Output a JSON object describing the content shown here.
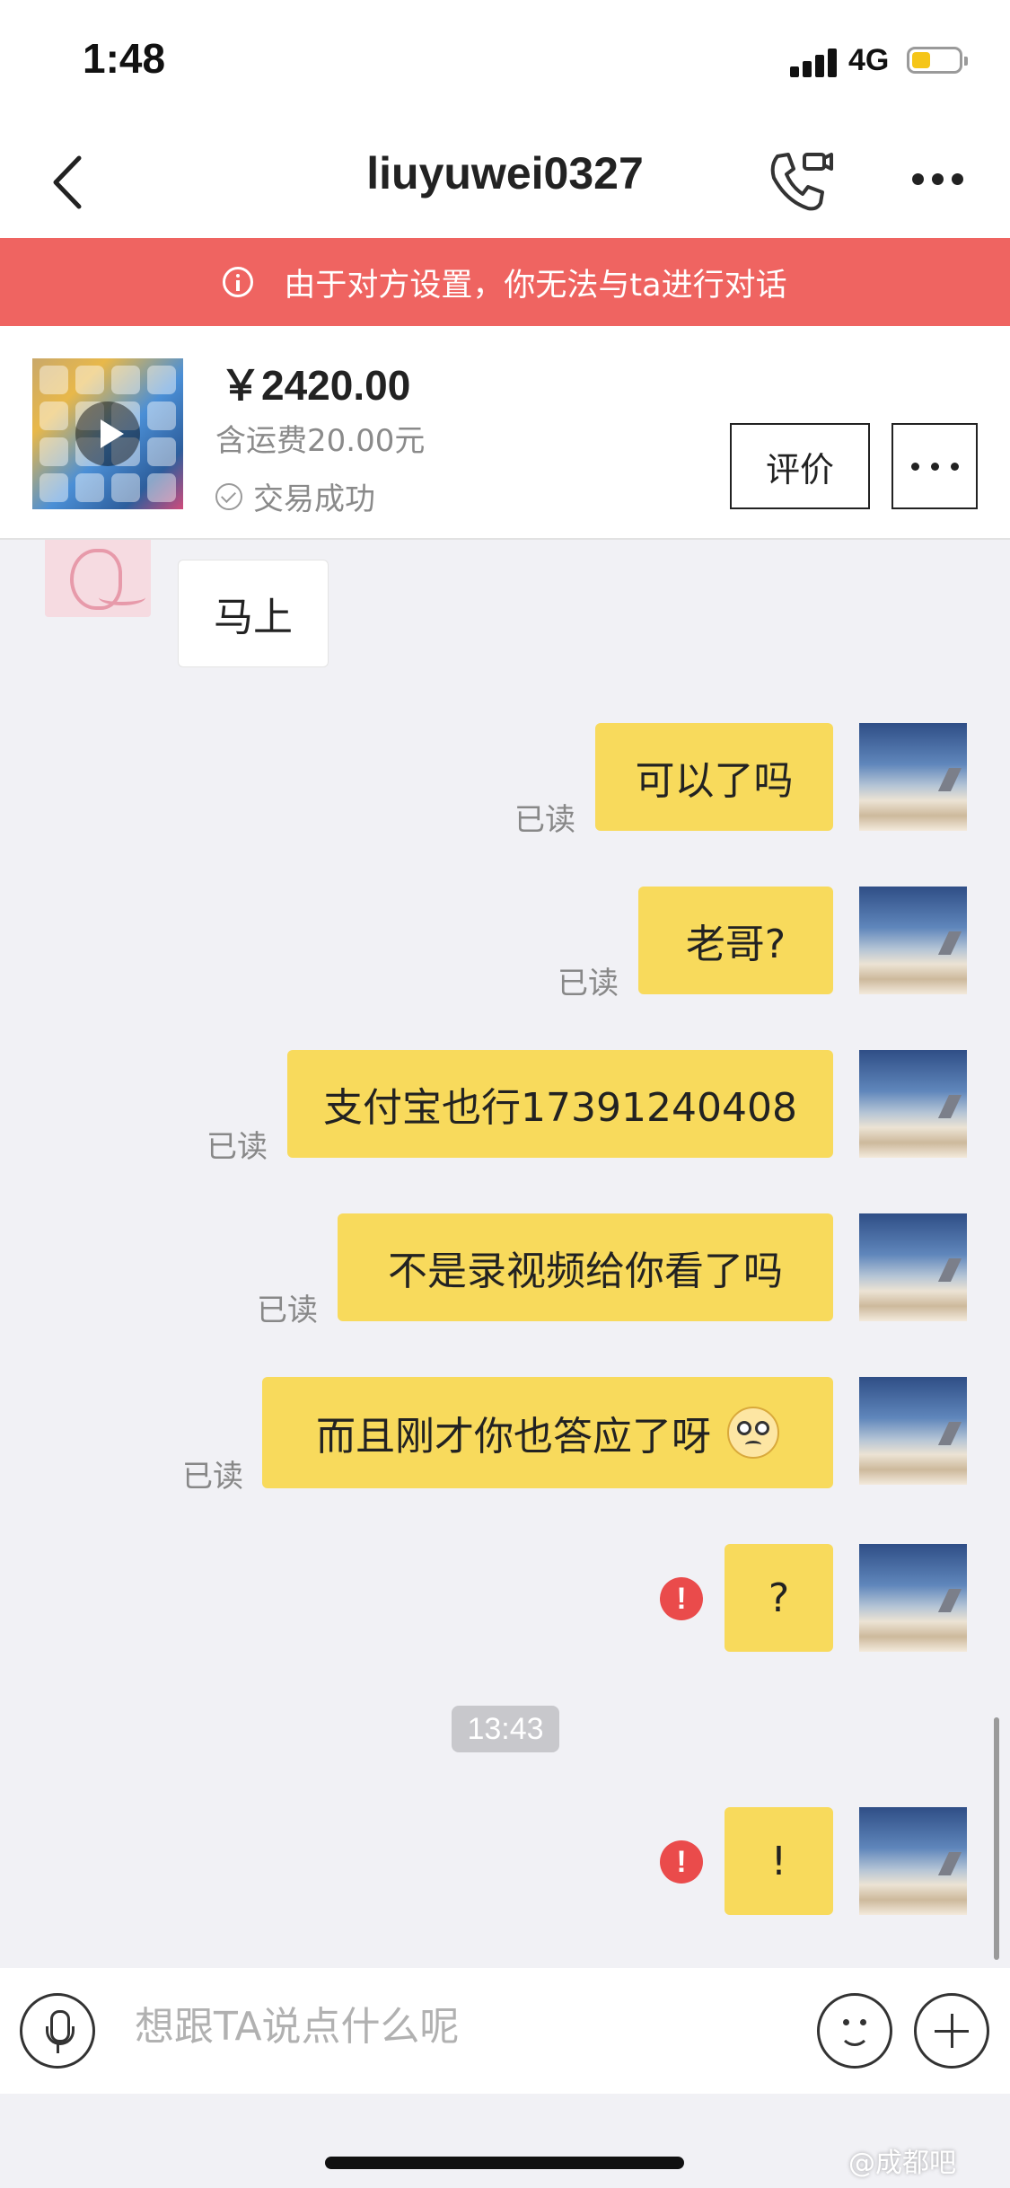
{
  "status_bar": {
    "time": "1:48",
    "network": "4G",
    "battery_level": 0.4
  },
  "nav": {
    "title": "liuyuwei0327",
    "back_icon": "chevron-left-icon",
    "call_icon": "phone-video-icon",
    "more_icon": "more-dots-icon"
  },
  "banner": {
    "text": "由于对方设置，你无法与ta进行对话",
    "color": "#ef6461",
    "icon": "info-icon"
  },
  "product": {
    "price": "￥2420.00",
    "shipping": "含运费20.00元",
    "status": "交易成功",
    "rate_label": "评价"
  },
  "messages": [
    {
      "side": "in",
      "text": "马上"
    },
    {
      "side": "out",
      "text": "可以了吗",
      "read": "已读"
    },
    {
      "side": "out",
      "text": "老哥?",
      "read": "已读"
    },
    {
      "side": "out",
      "text": "支付宝也行17391240408",
      "read": "已读"
    },
    {
      "side": "out",
      "text": "不是录视频给你看了吗",
      "read": "已读"
    },
    {
      "side": "out",
      "text": "而且刚才你也答应了呀",
      "read": "已读",
      "emoji": "worried-face-icon"
    },
    {
      "side": "out",
      "text": "?",
      "error": "!"
    },
    {
      "side": "out",
      "text": "!",
      "error": "!"
    }
  ],
  "timestamp": "13:43",
  "input": {
    "placeholder": "想跟TA说点什么呢"
  },
  "watermark": "@成都吧",
  "colors": {
    "outgoing_bubble": "#f8da5c",
    "incoming_bubble": "#ffffff",
    "chat_background": "#f1f1f5",
    "error": "#ea4b4b"
  }
}
